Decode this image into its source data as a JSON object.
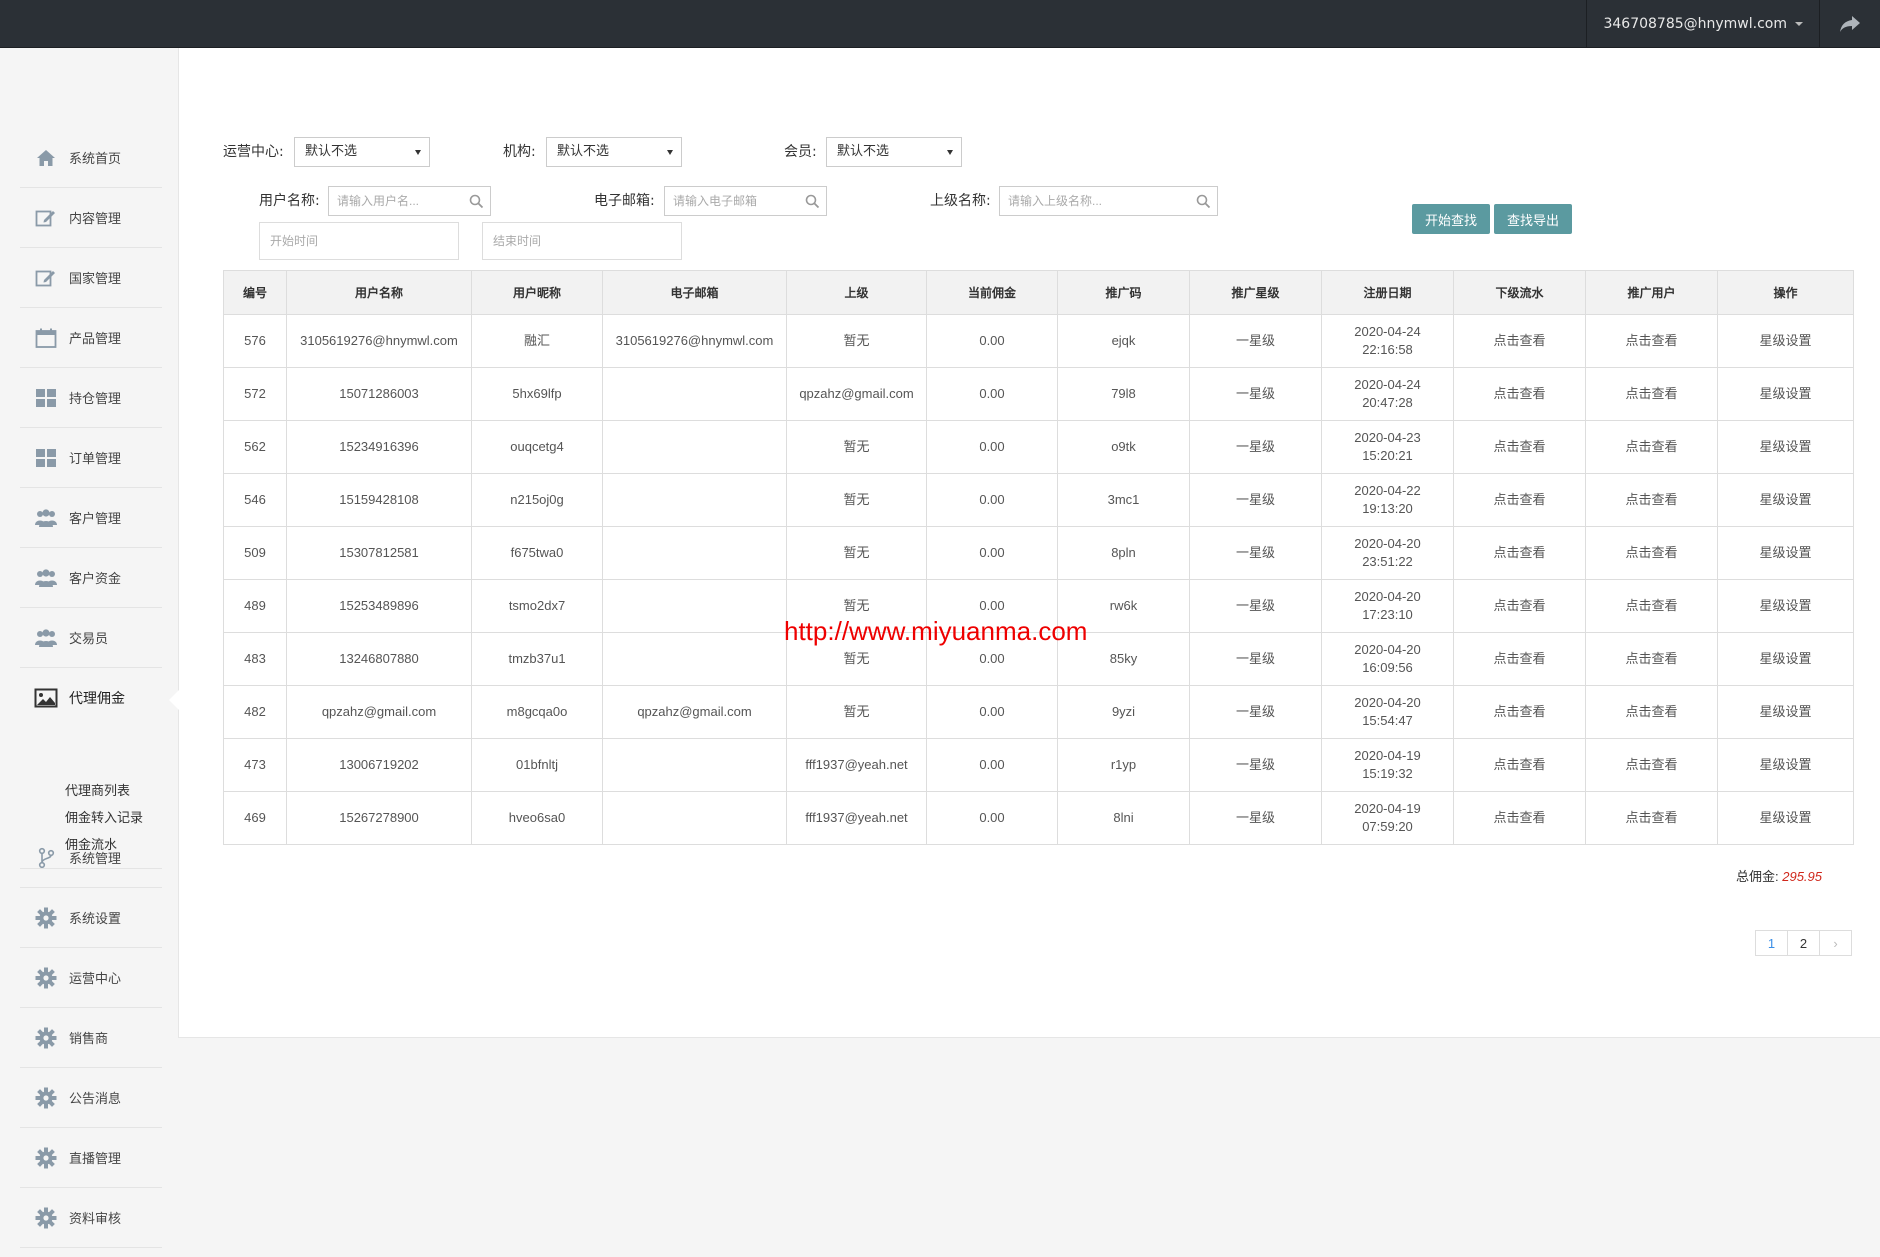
{
  "header": {
    "user_email": "346708785@hnymwl.com"
  },
  "sidebar": {
    "items": [
      {
        "label": "系统首页",
        "icon": "home-icon"
      },
      {
        "label": "内容管理",
        "icon": "edit-icon"
      },
      {
        "label": "国家管理",
        "icon": "edit-icon"
      },
      {
        "label": "产品管理",
        "icon": "calendar-icon"
      },
      {
        "label": "持仓管理",
        "icon": "grid-icon"
      },
      {
        "label": "订单管理",
        "icon": "grid-icon"
      },
      {
        "label": "客户管理",
        "icon": "users-icon"
      },
      {
        "label": "客户资金",
        "icon": "users-icon"
      },
      {
        "label": "交易员",
        "icon": "users-icon"
      },
      {
        "label": "代理佣金",
        "icon": "image-icon"
      },
      {
        "label": "系统管理",
        "icon": "branch-icon"
      },
      {
        "label": "系统设置",
        "icon": "gear-icon"
      },
      {
        "label": "运营中心",
        "icon": "gear-icon"
      },
      {
        "label": "销售商",
        "icon": "gear-icon"
      },
      {
        "label": "公告消息",
        "icon": "gear-icon"
      },
      {
        "label": "直播管理",
        "icon": "gear-icon"
      },
      {
        "label": "资料审核",
        "icon": "gear-icon"
      }
    ],
    "sub_items": [
      "代理商列表",
      "佣金转入记录",
      "佣金流水"
    ]
  },
  "filters": {
    "ops_center_label": "运营中心:",
    "ops_center_value": "默认不选",
    "org_label": "机构:",
    "org_value": "默认不选",
    "member_label": "会员:",
    "member_value": "默认不选",
    "username_label": "用户名称:",
    "username_placeholder": "请输入用户名...",
    "email_label": "电子邮箱:",
    "email_placeholder": "请输入电子邮箱",
    "parent_label": "上级名称:",
    "parent_placeholder": "请输入上级名称...",
    "start_placeholder": "开始时间",
    "end_placeholder": "结束时间",
    "search_btn": "开始查找",
    "export_btn": "查找导出"
  },
  "table": {
    "headers": [
      "编号",
      "用户名称",
      "用户昵称",
      "电子邮箱",
      "上级",
      "当前佣金",
      "推广码",
      "推广星级",
      "注册日期",
      "下级流水",
      "推广用户",
      "操作"
    ],
    "rows": [
      {
        "id": "576",
        "username": "3105619276@hnymwl.com",
        "nickname": "融汇",
        "email": "3105619276@hnymwl.com",
        "parent": "暂无",
        "commission": "0.00",
        "code": "ejqk",
        "star": "一星级",
        "date": "2020-04-24",
        "time": "22:16:58",
        "flow": "点击查看",
        "promo": "点击查看",
        "action": "星级设置"
      },
      {
        "id": "572",
        "username": "15071286003",
        "nickname": "5hx69lfp",
        "email": "",
        "parent": "qpzahz@gmail.com",
        "commission": "0.00",
        "code": "79l8",
        "star": "一星级",
        "date": "2020-04-24",
        "time": "20:47:28",
        "flow": "点击查看",
        "promo": "点击查看",
        "action": "星级设置"
      },
      {
        "id": "562",
        "username": "15234916396",
        "nickname": "ouqcetg4",
        "email": "",
        "parent": "暂无",
        "commission": "0.00",
        "code": "o9tk",
        "star": "一星级",
        "date": "2020-04-23",
        "time": "15:20:21",
        "flow": "点击查看",
        "promo": "点击查看",
        "action": "星级设置"
      },
      {
        "id": "546",
        "username": "15159428108",
        "nickname": "n215oj0g",
        "email": "",
        "parent": "暂无",
        "commission": "0.00",
        "code": "3mc1",
        "star": "一星级",
        "date": "2020-04-22",
        "time": "19:13:20",
        "flow": "点击查看",
        "promo": "点击查看",
        "action": "星级设置"
      },
      {
        "id": "509",
        "username": "15307812581",
        "nickname": "f675twa0",
        "email": "",
        "parent": "暂无",
        "commission": "0.00",
        "code": "8pln",
        "star": "一星级",
        "date": "2020-04-20",
        "time": "23:51:22",
        "flow": "点击查看",
        "promo": "点击查看",
        "action": "星级设置"
      },
      {
        "id": "489",
        "username": "15253489896",
        "nickname": "tsmo2dx7",
        "email": "",
        "parent": "暂无",
        "commission": "0.00",
        "code": "rw6k",
        "star": "一星级",
        "date": "2020-04-20",
        "time": "17:23:10",
        "flow": "点击查看",
        "promo": "点击查看",
        "action": "星级设置"
      },
      {
        "id": "483",
        "username": "13246807880",
        "nickname": "tmzb37u1",
        "email": "",
        "parent": "暂无",
        "commission": "0.00",
        "code": "85ky",
        "star": "一星级",
        "date": "2020-04-20",
        "time": "16:09:56",
        "flow": "点击查看",
        "promo": "点击查看",
        "action": "星级设置"
      },
      {
        "id": "482",
        "username": "qpzahz@gmail.com",
        "nickname": "m8gcqa0o",
        "email": "qpzahz@gmail.com",
        "parent": "暂无",
        "commission": "0.00",
        "code": "9yzi",
        "star": "一星级",
        "date": "2020-04-20",
        "time": "15:54:47",
        "flow": "点击查看",
        "promo": "点击查看",
        "action": "星级设置"
      },
      {
        "id": "473",
        "username": "13006719202",
        "nickname": "01bfnltj",
        "email": "",
        "parent": "fff1937@yeah.net",
        "commission": "0.00",
        "code": "r1yp",
        "star": "一星级",
        "date": "2020-04-19",
        "time": "15:19:32",
        "flow": "点击查看",
        "promo": "点击查看",
        "action": "星级设置"
      },
      {
        "id": "469",
        "username": "15267278900",
        "nickname": "hveo6sa0",
        "email": "",
        "parent": "fff1937@yeah.net",
        "commission": "0.00",
        "code": "8lni",
        "star": "一星级",
        "date": "2020-04-19",
        "time": "07:59:20",
        "flow": "点击查看",
        "promo": "点击查看",
        "action": "星级设置"
      }
    ]
  },
  "watermark": "http://www.miyuanma.com",
  "summary": {
    "total_label": "总佣金:",
    "total_value": "295.95"
  },
  "pagination": {
    "pages": [
      "1",
      "2"
    ],
    "current": "1",
    "next": "›"
  },
  "colors": {
    "topbar": "#2b3036",
    "button": "#5b9aa0",
    "accent_red": "#d0281c",
    "link_blue": "#3a8ee6"
  }
}
